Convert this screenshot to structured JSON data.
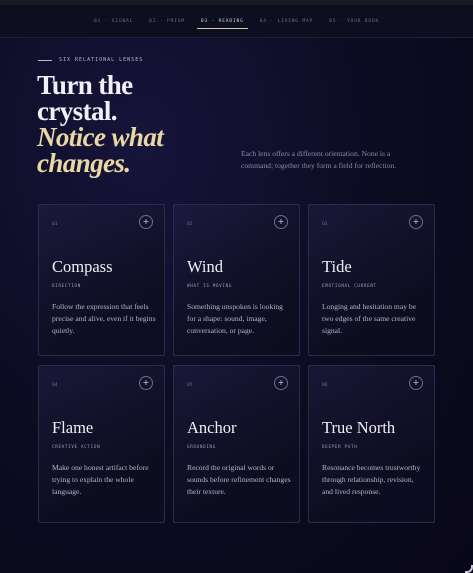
{
  "nav": {
    "items": [
      {
        "label": "01 · SIGNAL",
        "active": false
      },
      {
        "label": "02 · PRISM",
        "active": false
      },
      {
        "label": "03 · READING",
        "active": true
      },
      {
        "label": "04 · LIVING MAP",
        "active": false
      },
      {
        "label": "05 · YOUR BOOK",
        "active": false
      }
    ]
  },
  "hero": {
    "eyebrow": "SIX RELATIONAL LENSES",
    "headline_line1": "Turn the",
    "headline_line2": "crystal.",
    "headline_line3": "Notice what",
    "headline_line4": "changes.",
    "intro": "Each lens offers a different orientation. None is a command; together they form a field for reflection."
  },
  "cards": [
    {
      "num": "01",
      "title": "Compass",
      "sub": "DIRECTION",
      "desc": "Follow the expression that feels precise and alive, even if it begins quietly."
    },
    {
      "num": "02",
      "title": "Wind",
      "sub": "WHAT IS MOVING",
      "desc": "Something unspoken is looking for a shape: sound, image, conversation, or page."
    },
    {
      "num": "03",
      "title": "Tide",
      "sub": "EMOTIONAL CURRENT",
      "desc": "Longing and hesitation may be two edges of the same creative signal."
    },
    {
      "num": "04",
      "title": "Flame",
      "sub": "CREATIVE ACTION",
      "desc": "Make one honest artifact before trying to explain the whole language."
    },
    {
      "num": "05",
      "title": "Anchor",
      "sub": "GROUNDING",
      "desc": "Record the original words or sounds before refinement changes their texture."
    },
    {
      "num": "06",
      "title": "True North",
      "sub": "DEEPER PATH",
      "desc": "Resonance becomes trustworthy through relationship, revision, and lived response."
    }
  ],
  "card_plus_glyph": "+",
  "colors": {
    "accent_gold": "#e9d7a4",
    "background": "#0b0a1c",
    "card_border": "#2c2c4a"
  }
}
